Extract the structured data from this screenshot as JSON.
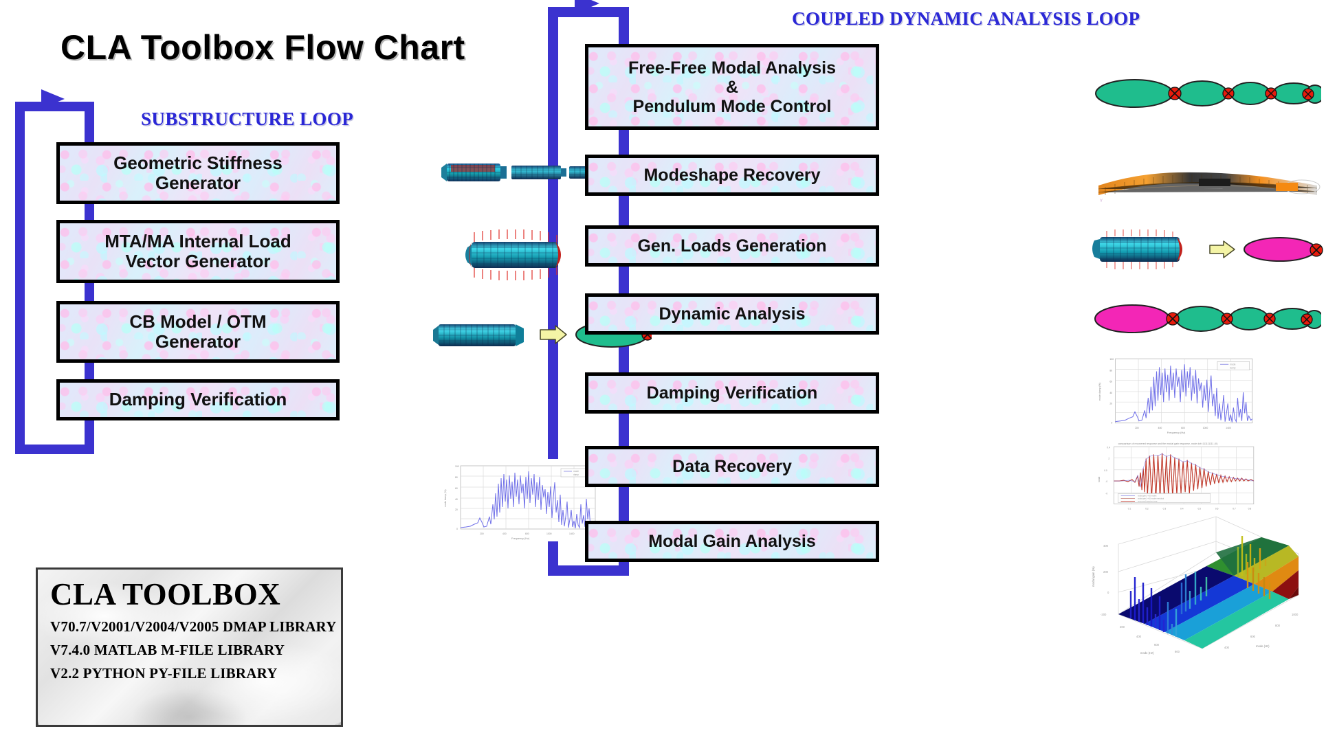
{
  "title": "CLA Toolbox Flow Chart",
  "loops": {
    "left": {
      "label": "SUBSTRUCTURE LOOP"
    },
    "right": {
      "label": "COUPLED DYNAMIC ANALYSIS LOOP"
    }
  },
  "colors": {
    "loop_arrow": "#3b32cf",
    "loop_title": "#2a27d6",
    "box_border": "#000000",
    "box_fill": "#dde8f8",
    "ellipse_green": "#1fbd8d",
    "ellipse_magenta": "#f326b6",
    "node_red": "#e81c0d",
    "arrow_yellow": "#f2f2a0",
    "fem_teal": "#1a8fa3",
    "modeshape_orange": "#f08a16",
    "plot_blue": "#6f6fe8",
    "plot_red": "#c0392b"
  },
  "substructure_loop": {
    "steps": [
      {
        "label": "Geometric Stiffness\nGenerator",
        "thumb": "fem-rocket-stack-thumb"
      },
      {
        "label": "MTA/MA Internal Load\nVector Generator",
        "thumb": "fem-loaded-cylinder-thumb"
      },
      {
        "label": "CB Model / OTM\nGenerator",
        "thumb": "cb-reduction-thumb"
      },
      {
        "label": "Damping Verification",
        "thumb": "damping-spectrum-plot-thumb"
      }
    ]
  },
  "coupled_dynamic_loop": {
    "steps": [
      {
        "label": "Free-Free Modal Analysis\n&\nPendulum Mode Control",
        "thumb": "modal-ellipse-chain-thumb"
      },
      {
        "label": "Modeshape Recovery",
        "thumb": "modeshape-deformed-rocket-thumb"
      },
      {
        "label": "Gen. Loads Generation",
        "thumb": "gen-loads-reduction-thumb"
      },
      {
        "label": "Dynamic Analysis",
        "thumb": "coupled-ellipse-chain-thumb"
      },
      {
        "label": "Damping Verification",
        "thumb": "damping-spectrum-plot-thumb"
      },
      {
        "label": "Data Recovery",
        "thumb": "time-history-plot-thumb"
      },
      {
        "label": "Modal Gain Analysis",
        "thumb": "modal-gain-surface-plot-thumb"
      }
    ]
  },
  "legend": {
    "title": "CLA TOOLBOX",
    "lines": [
      "V70.7/V2001/V2004/V2005 DMAP LIBRARY",
      "V7.4.0 MATLAB M-FILE LIBRARY",
      "V2.2 PYTHON PY-FILE LIBRARY"
    ]
  }
}
